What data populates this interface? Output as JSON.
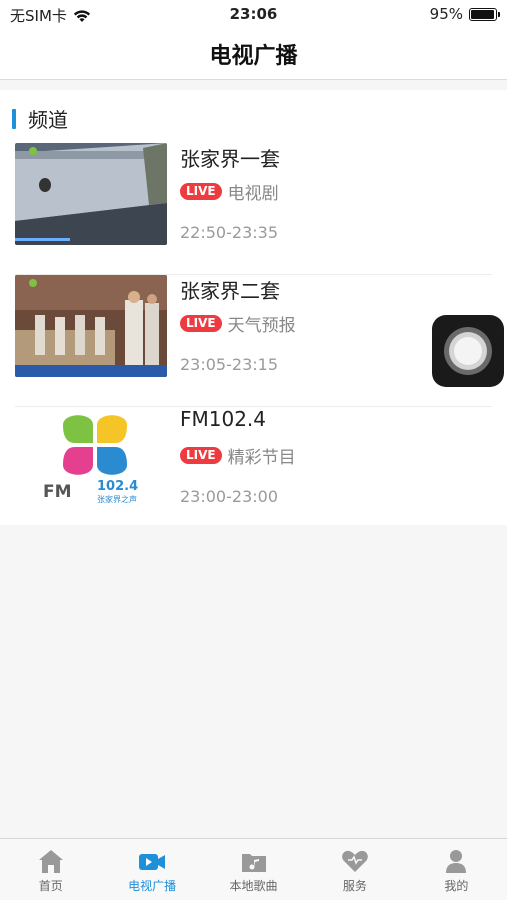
{
  "status_bar": {
    "carrier": "无SIM卡",
    "time": "23:06",
    "battery": "95%",
    "battery_level": 0.95
  },
  "nav": {
    "title": "电视广播"
  },
  "section": {
    "title": "频道"
  },
  "channels": [
    {
      "name": "张家界一套",
      "live": "LIVE",
      "program": "电视剧",
      "time": "22:50-23:35"
    },
    {
      "name": "张家界二套",
      "live": "LIVE",
      "program": "天气预报",
      "time": "23:05-23:15"
    },
    {
      "name": "FM102.4",
      "live": "LIVE",
      "program": "精彩节目",
      "time": "23:00-23:00",
      "logo_text": "FM",
      "logo_freq": "102.4",
      "logo_sub": "张家界之声"
    }
  ],
  "tabs": [
    {
      "label": "首页",
      "icon": "home-icon"
    },
    {
      "label": "电视广播",
      "icon": "video-camera-icon"
    },
    {
      "label": "本地歌曲",
      "icon": "music-folder-icon"
    },
    {
      "label": "服务",
      "icon": "heart-icon"
    },
    {
      "label": "我的",
      "icon": "user-icon"
    }
  ],
  "colors": {
    "accent": "#1e90d8",
    "live": "#ee3b40",
    "tab_inactive": "#999999"
  }
}
